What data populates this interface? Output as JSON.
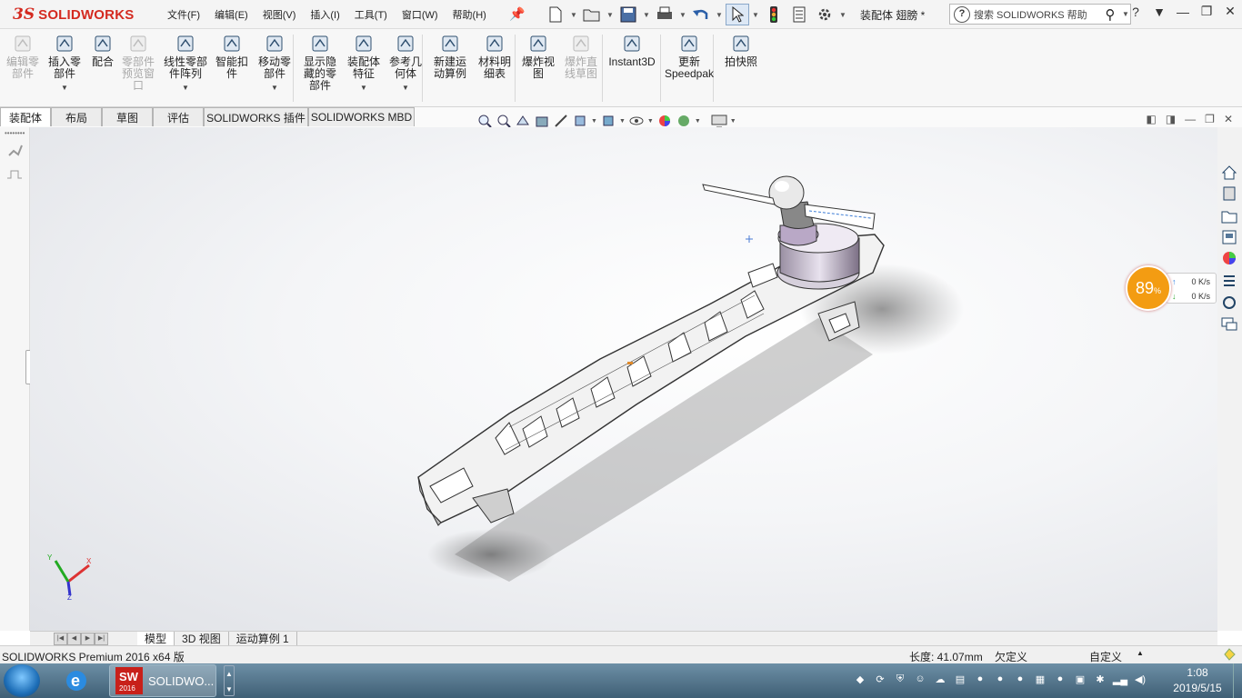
{
  "app": {
    "brand_ds": "3S",
    "brand_name": "SOLIDWORKS",
    "doc_title": "装配体 翅膀 *"
  },
  "menu": [
    "文件(F)",
    "编辑(E)",
    "视图(V)",
    "插入(I)",
    "工具(T)",
    "窗口(W)",
    "帮助(H)"
  ],
  "search": {
    "placeholder": "搜索 SOLIDWORKS 帮助"
  },
  "ribbon": {
    "items": [
      {
        "label": "编辑零\n部件",
        "icon": "edit-component-icon",
        "disabled": true
      },
      {
        "label": "插入零\n部件",
        "icon": "insert-component-icon",
        "disabled": false,
        "dropdown": true
      },
      {
        "label": "配合",
        "icon": "mate-icon",
        "disabled": false
      },
      {
        "label": "零部件\n预览窗\n口",
        "icon": "component-preview-icon",
        "disabled": true
      },
      {
        "label": "线性零部\n件阵列",
        "icon": "linear-pattern-icon",
        "disabled": false,
        "dropdown": true
      },
      {
        "label": "智能扣\n件",
        "icon": "smart-fastener-icon",
        "disabled": false
      },
      {
        "label": "移动零\n部件",
        "icon": "move-component-icon",
        "disabled": false,
        "dropdown": true
      },
      {
        "label": "显示隐\n藏的零\n部件",
        "icon": "show-hidden-icon",
        "disabled": false
      },
      {
        "label": "装配体\n特征",
        "icon": "assembly-feature-icon",
        "disabled": false,
        "dropdown": true
      },
      {
        "label": "参考几\n何体",
        "icon": "reference-geometry-icon",
        "disabled": false,
        "dropdown": true
      },
      {
        "label": "新建运\n动算例",
        "icon": "new-motion-study-icon",
        "disabled": false
      },
      {
        "label": "材料明\n细表",
        "icon": "bill-of-materials-icon",
        "disabled": false
      },
      {
        "label": "爆炸视\n图",
        "icon": "exploded-view-icon",
        "disabled": false
      },
      {
        "label": "爆炸直\n线草图",
        "icon": "explode-line-sketch-icon",
        "disabled": true
      },
      {
        "label": "Instant3D",
        "icon": "instant3d-icon",
        "disabled": false
      },
      {
        "label": "更新\nSpeedpak",
        "icon": "speedpak-icon",
        "disabled": false
      },
      {
        "label": "拍快照",
        "icon": "snapshot-icon",
        "disabled": false
      }
    ]
  },
  "tabs": [
    "装配体",
    "布局",
    "草图",
    "评估",
    "SOLIDWORKS 插件",
    "SOLIDWORKS MBD"
  ],
  "active_tab": "装配体",
  "netmeter": {
    "percent": "89",
    "percent_unit": "%",
    "up": "0 K/s",
    "down": "0 K/s"
  },
  "bottom_tabs": [
    "模型",
    "3D 视图",
    "运动算例 1"
  ],
  "active_bottom_tab": "模型",
  "status": {
    "product": "SOLIDWORKS Premium 2016 x64 版",
    "length": "长度: 41.07mm",
    "state": "欠定义",
    "custom": "自定义"
  },
  "taskbar": {
    "sw_label": "SOLIDWO...",
    "sw_year": "2016",
    "time": "1:08",
    "date": "2019/5/15"
  },
  "axes": {
    "x": "X",
    "y": "Y",
    "z": "Z"
  },
  "colors": {
    "brand_red": "#d42a20",
    "netmeter_orange": "#f39c12",
    "taskbar_top": "#6d8fa6"
  }
}
